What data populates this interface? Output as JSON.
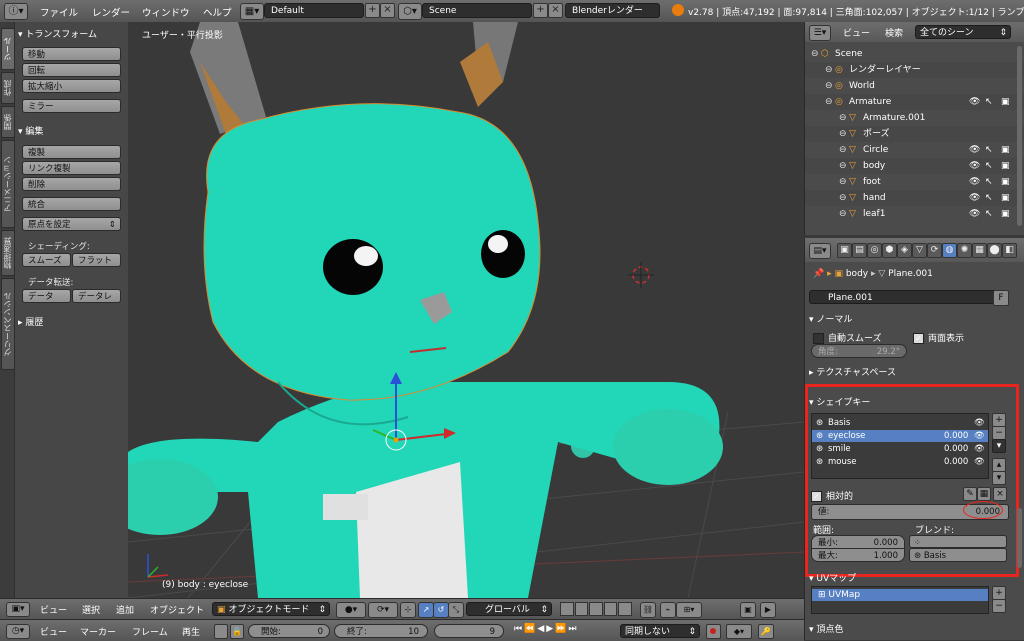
{
  "topbar": {
    "menu": [
      "ファイル",
      "レンダー",
      "ウィンドウ",
      "ヘルプ"
    ],
    "screen_layout": "Default",
    "scene": "Scene",
    "render_engine": "Blenderレンダー",
    "stats": "v2.78 | 頂点:47,192 | 面:97,814 | 三角面:102,057 | オブジェクト:1/12 | ランプ"
  },
  "toolshelf": {
    "tabs": [
      "ツール",
      "作成",
      "関係",
      "アニメーション",
      "物理演算",
      "グリースペンシル"
    ],
    "transform_header": "トランスフォーム",
    "transform_buttons": [
      "移動",
      "回転",
      "拡大縮小"
    ],
    "mirror_button": "ミラー",
    "edit_header": "編集",
    "edit_buttons": [
      "複製",
      "リンク複製",
      "削除"
    ],
    "join_button": "統合",
    "origin_button": "原点を設定",
    "shading_label": "シェーディング:",
    "smooth_button": "スムーズ",
    "flat_button": "フラット",
    "data_transfer_label": "データ転送:",
    "data_button": "データ",
    "data_layers_button": "データレ",
    "history_header": "履歴"
  },
  "viewport": {
    "view_label": "ユーザー・平行投影",
    "object_info": "(9) body : eyeclose"
  },
  "outliner": {
    "view": "ビュー",
    "search": "検索",
    "display": "全てのシーン",
    "rows": [
      {
        "label": "Scene",
        "indent": 0
      },
      {
        "label": "レンダーレイヤー",
        "indent": 1
      },
      {
        "label": "World",
        "indent": 1
      },
      {
        "label": "Armature",
        "indent": 1
      },
      {
        "label": "Armature.001",
        "indent": 2
      },
      {
        "label": "ポーズ",
        "indent": 2
      },
      {
        "label": "Circle",
        "indent": 2
      },
      {
        "label": "body",
        "indent": 2
      },
      {
        "label": "foot",
        "indent": 2
      },
      {
        "label": "hand",
        "indent": 2
      },
      {
        "label": "leaf1",
        "indent": 2
      }
    ]
  },
  "properties": {
    "breadcrumb_object": "body",
    "breadcrumb_mesh": "Plane.001",
    "mesh_name": "Plane.001",
    "fake_user": "F",
    "normal_header": "ノーマル",
    "auto_smooth": "自動スムーズ",
    "double_sided": "両面表示",
    "angle_label": "角度:",
    "angle_value": "29.2°",
    "texture_space_header": "テクスチャスペース",
    "shapekeys_header": "シェイプキー",
    "shapekeys": [
      {
        "name": "Basis",
        "value": ""
      },
      {
        "name": "eyeclose",
        "value": "0.000"
      },
      {
        "name": "smile",
        "value": "0.000"
      },
      {
        "name": "mouse",
        "value": "0.000"
      }
    ],
    "relative_label": "相対的",
    "value_label": "値:",
    "value": "0.000",
    "range_label": "範囲:",
    "min_label": "最小:",
    "min_value": "0.000",
    "max_label": "最大:",
    "max_value": "1.000",
    "blend_label": "ブレンド:",
    "blend_value": "Basis",
    "uvmaps_header": "UVマップ",
    "uvmap_name": "UVMap",
    "vertex_color_header": "頂点色",
    "highlight_color": "#e8261f"
  },
  "view3d_header": {
    "view": "ビュー",
    "select": "選択",
    "add": "追加",
    "object": "オブジェクト",
    "mode": "オブジェクトモード",
    "orientation": "グローバル"
  },
  "timeline": {
    "view": "ビュー",
    "marker": "マーカー",
    "frame": "フレーム",
    "play": "再生",
    "start_label": "開始:",
    "start_value": "0",
    "end_label": "終了:",
    "end_value": "10",
    "current_frame": "9",
    "sync": "同期しない"
  }
}
